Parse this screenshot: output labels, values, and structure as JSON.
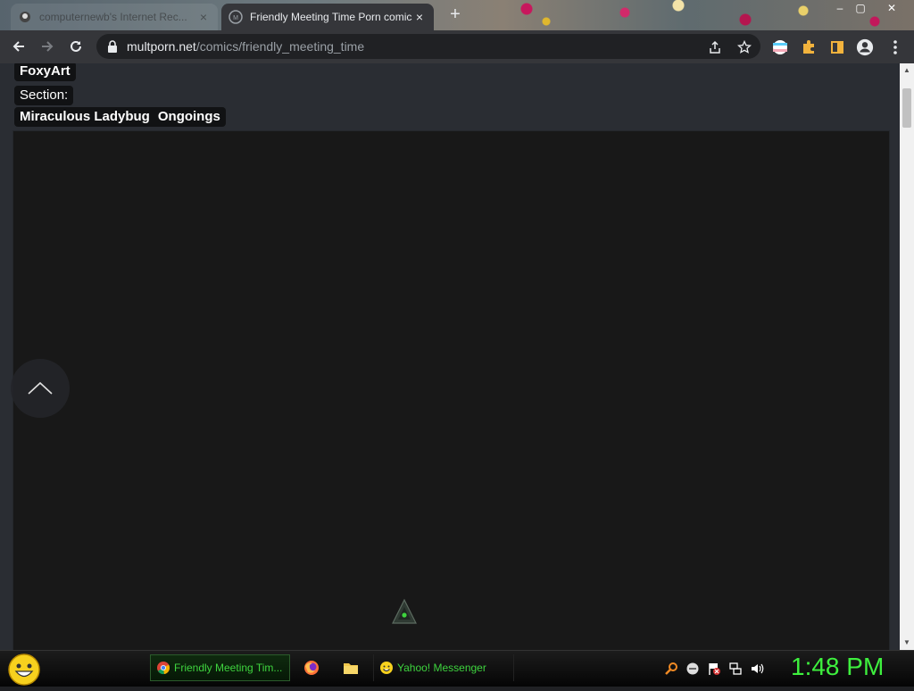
{
  "browser": {
    "tabs": [
      {
        "title": "computernewb's Internet Rec...",
        "active": false
      },
      {
        "title": "Friendly Meeting Time Porn comics",
        "active": true
      }
    ],
    "new_tab_symbol": "+",
    "close_symbol": "×",
    "window_controls": {
      "minimize": "–",
      "maximize": "▢",
      "close": "✕"
    },
    "url": {
      "host": "multporn.net",
      "path": "/comics/friendly_meeting_time"
    },
    "toolbar_icons": [
      "back-arrow-icon",
      "forward-arrow-icon",
      "reload-icon",
      "lock-icon",
      "share-icon",
      "star-icon",
      "flag-extension-icon",
      "puzzle-icon",
      "side-panel-icon",
      "profile-icon",
      "kebab-menu-icon"
    ]
  },
  "page": {
    "author": "FoxyArt",
    "section_label": "Section:",
    "section_tags": [
      "Miraculous Ladybug",
      "Ongoings"
    ],
    "colors": {
      "background": "#2a2d33",
      "frame": "#181818",
      "tag_bg": "#111214"
    }
  },
  "taskbar": {
    "tasks": [
      {
        "label": "Friendly Meeting Tim...",
        "icon": "chrome-icon",
        "active": true
      },
      {
        "label": "",
        "icon": "firefox-icon"
      },
      {
        "label": "",
        "icon": "folder-icon"
      },
      {
        "label": "Yahoo! Messenger",
        "icon": "yahoo-smiley-icon"
      }
    ],
    "clock": "1:48 PM",
    "accent": "#3ef03e"
  }
}
